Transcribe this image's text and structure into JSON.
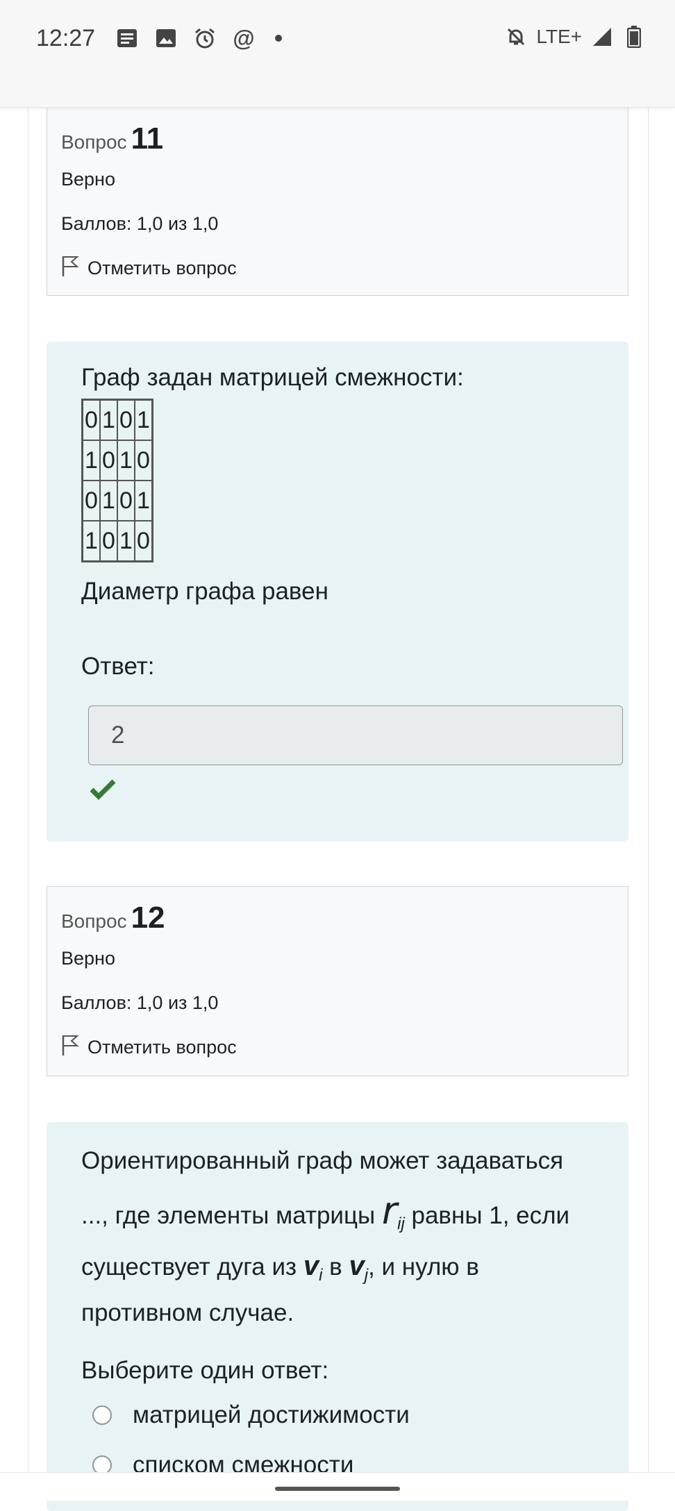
{
  "status_bar": {
    "time": "12:27",
    "network": "LTE+",
    "left_icons": [
      "notes-icon",
      "image-icon",
      "alarm-icon",
      "at-icon",
      "dot-icon"
    ],
    "right_icons": [
      "bell-off-icon",
      "signal-icon",
      "battery-icon"
    ]
  },
  "q11": {
    "label": "Вопрос",
    "number": "11",
    "state": "Верно",
    "grade": "Баллов: 1,0 из 1,0",
    "flag_label": "Отметить вопрос",
    "text_intro": "Граф задан матрицей смежности:",
    "matrix": [
      [
        "0",
        "1",
        "0",
        "1"
      ],
      [
        "1",
        "0",
        "1",
        "0"
      ],
      [
        "0",
        "1",
        "0",
        "1"
      ],
      [
        "1",
        "0",
        "1",
        "0"
      ]
    ],
    "text_after": "Диаметр графа равен",
    "answer_label": "Ответ:",
    "answer_value": "2",
    "correct_color": "#357a32"
  },
  "q12": {
    "label": "Вопрос",
    "number": "12",
    "state": "Верно",
    "grade": "Баллов: 1,0 из 1,0",
    "flag_label": "Отметить вопрос",
    "text_line1": "Ориентированный граф может задаваться",
    "text_line2_a": "..., где элементы матрицы ",
    "text_line2_r": "r",
    "text_line2_sub": "ij",
    "text_line2_b": " равны 1, если",
    "text_line3_a": "существует дуга из ",
    "text_v": "v",
    "text_sub_i": "i",
    "text_line3_in": " в ",
    "text_sub_j": "j",
    "text_line3_b": ", и нулю в",
    "text_line4": "противном случае.",
    "select_prompt": "Выберите один ответ:",
    "options": [
      "матрицей достижимости",
      "списком смежности"
    ]
  },
  "colors": {
    "info_bg": "#f8f9fa",
    "content_bg": "#e7f3f5",
    "input_bg": "#e9ecef"
  }
}
